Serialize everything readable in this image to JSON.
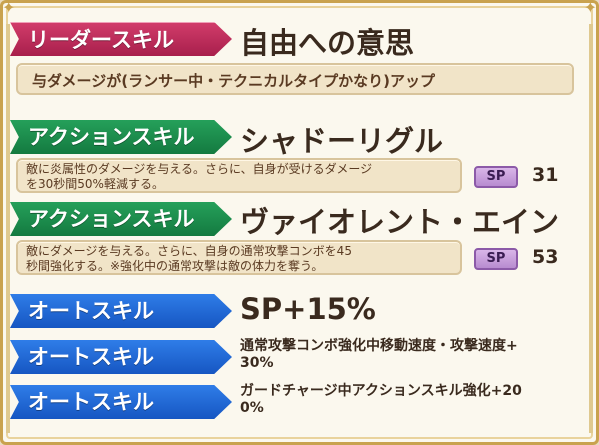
{
  "leader": {
    "label": "リーダースキル",
    "title": "自由への意思",
    "description": "与ダメージが(ランサー中・テクニカルタイプかなり)アップ"
  },
  "action_skills": [
    {
      "label": "アクションスキル",
      "title": "シャドーリグル",
      "description_line1": "敵に炎属性のダメージを与える。さらに、自身が受けるダメージ",
      "description_line2": "を30秒間50%軽減する。",
      "sp_label": "SP",
      "sp_value": "31"
    },
    {
      "label": "アクションスキル",
      "title": "ヴァイオレント・エイン",
      "description_line1": "敵にダメージを与える。さらに、自身の通常攻撃コンボを45",
      "description_line2": "秒間強化する。※強化中の通常攻撃は敵の体力を奪う。",
      "sp_label": "SP",
      "sp_value": "53"
    }
  ],
  "auto_skills": [
    {
      "label": "オートスキル",
      "text_line1": "SP+15%",
      "text_line2": ""
    },
    {
      "label": "オートスキル",
      "text_line1": "通常攻撃コンボ強化中移動速度・攻撃速度+",
      "text_line2": "30%"
    },
    {
      "label": "オートスキル",
      "text_line1": "ガードチャージ中アクションスキル強化+20",
      "text_line2": "0%"
    }
  ],
  "colors": {
    "leader_banner": "#c02a58",
    "action_banner": "#1e8c4c",
    "auto_banner": "#2266d8",
    "frame_gold": "#c9a24e"
  }
}
